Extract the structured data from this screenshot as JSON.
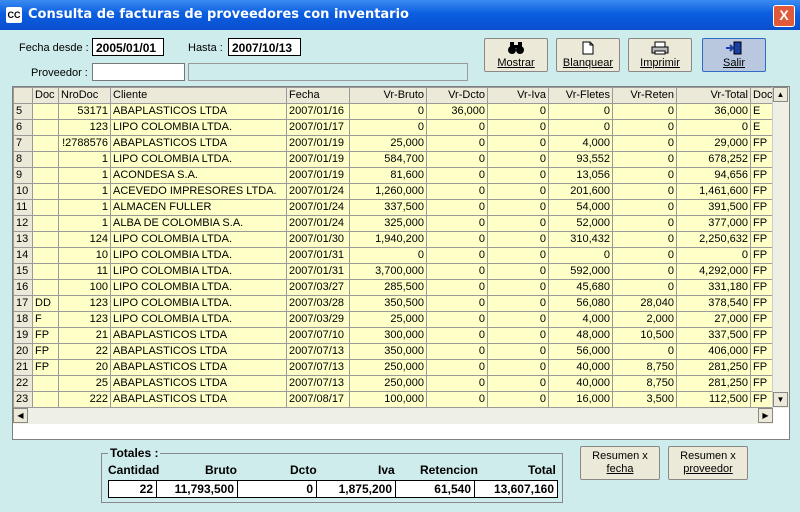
{
  "window": {
    "title": "Consulta de facturas de proveedores con inventario",
    "icon_text": "CC",
    "close_label": "X"
  },
  "filters": {
    "fecha_desde_label": "Fecha desde :",
    "fecha_desde_value": "2005/01/01",
    "hasta_label": "Hasta :",
    "hasta_value": "2007/10/13",
    "proveedor_label": "Proveedor :",
    "proveedor_value": "",
    "proveedor_name": ""
  },
  "toolbar": {
    "mostrar": "Mostrar",
    "blanquear": "Blanquear",
    "imprimir": "Imprimir",
    "salir": "Salir"
  },
  "grid": {
    "columns": [
      "",
      "Doc",
      "NroDoc",
      "Cliente",
      "Fecha",
      "Vr-Bruto",
      "Vr-Dcto",
      "Vr-Iva",
      "Vr-Fletes",
      "Vr-Reten",
      "Vr-Total",
      "Doc"
    ],
    "rows": [
      [
        "5",
        "",
        "53171",
        "ABAPLASTICOS LTDA",
        "2007/01/16",
        "0",
        "36,000",
        "0",
        "0",
        "0",
        "36,000",
        "E"
      ],
      [
        "6",
        "",
        "123",
        "LIPO COLOMBIA LTDA.",
        "2007/01/17",
        "0",
        "0",
        "0",
        "0",
        "0",
        "0",
        "E"
      ],
      [
        "7",
        "",
        "!2788576",
        "ABAPLASTICOS LTDA",
        "2007/01/19",
        "25,000",
        "0",
        "0",
        "4,000",
        "0",
        "29,000",
        "FP"
      ],
      [
        "8",
        "",
        "1",
        "LIPO COLOMBIA LTDA.",
        "2007/01/19",
        "584,700",
        "0",
        "0",
        "93,552",
        "0",
        "678,252",
        "FP"
      ],
      [
        "9",
        "",
        "1",
        "ACONDESA S.A.",
        "2007/01/19",
        "81,600",
        "0",
        "0",
        "13,056",
        "0",
        "94,656",
        "FP"
      ],
      [
        "10",
        "",
        "1",
        "ACEVEDO IMPRESORES LTDA.",
        "2007/01/24",
        "1,260,000",
        "0",
        "0",
        "201,600",
        "0",
        "1,461,600",
        "FP"
      ],
      [
        "11",
        "",
        "1",
        "ALMACEN FULLER",
        "2007/01/24",
        "337,500",
        "0",
        "0",
        "54,000",
        "0",
        "391,500",
        "FP"
      ],
      [
        "12",
        "",
        "1",
        "ALBA DE COLOMBIA S.A.",
        "2007/01/24",
        "325,000",
        "0",
        "0",
        "52,000",
        "0",
        "377,000",
        "FP"
      ],
      [
        "13",
        "",
        "124",
        "LIPO COLOMBIA LTDA.",
        "2007/01/30",
        "1,940,200",
        "0",
        "0",
        "310,432",
        "0",
        "2,250,632",
        "FP"
      ],
      [
        "14",
        "",
        "10",
        "LIPO COLOMBIA LTDA.",
        "2007/01/31",
        "0",
        "0",
        "0",
        "0",
        "0",
        "0",
        "FP"
      ],
      [
        "15",
        "",
        "11",
        "LIPO COLOMBIA LTDA.",
        "2007/01/31",
        "3,700,000",
        "0",
        "0",
        "592,000",
        "0",
        "4,292,000",
        "FP"
      ],
      [
        "16",
        "",
        "100",
        "LIPO COLOMBIA LTDA.",
        "2007/03/27",
        "285,500",
        "0",
        "0",
        "45,680",
        "0",
        "331,180",
        "FP"
      ],
      [
        "17",
        "DD",
        "123",
        "LIPO COLOMBIA LTDA.",
        "2007/03/28",
        "350,500",
        "0",
        "0",
        "56,080",
        "28,040",
        "378,540",
        "FP"
      ],
      [
        "18",
        "F",
        "123",
        "LIPO COLOMBIA LTDA.",
        "2007/03/29",
        "25,000",
        "0",
        "0",
        "4,000",
        "2,000",
        "27,000",
        "FP"
      ],
      [
        "19",
        "FP",
        "21",
        "ABAPLASTICOS LTDA",
        "2007/07/10",
        "300,000",
        "0",
        "0",
        "48,000",
        "10,500",
        "337,500",
        "FP"
      ],
      [
        "20",
        "FP",
        "22",
        "ABAPLASTICOS LTDA",
        "2007/07/13",
        "350,000",
        "0",
        "0",
        "56,000",
        "0",
        "406,000",
        "FP"
      ],
      [
        "21",
        "FP",
        "20",
        "ABAPLASTICOS LTDA",
        "2007/07/13",
        "250,000",
        "0",
        "0",
        "40,000",
        "8,750",
        "281,250",
        "FP"
      ],
      [
        "22",
        "",
        "25",
        "ABAPLASTICOS LTDA",
        "2007/07/13",
        "250,000",
        "0",
        "0",
        "40,000",
        "8,750",
        "281,250",
        "FP"
      ],
      [
        "23",
        "",
        "222",
        "ABAPLASTICOS LTDA",
        "2007/08/17",
        "100,000",
        "0",
        "0",
        "16,000",
        "3,500",
        "112,500",
        "FP"
      ]
    ]
  },
  "totals": {
    "title": "Totales :",
    "headers": [
      "Cantidad",
      "Bruto",
      "Dcto",
      "Iva",
      "Retencion",
      "Total"
    ],
    "values": [
      "22",
      "11,793,500",
      "0",
      "1,875,200",
      "61,540",
      "13,607,160"
    ]
  },
  "summary_buttons": {
    "by_date": [
      "Resumen x",
      "fecha"
    ],
    "by_supplier": [
      "Resumen x",
      "proveedor"
    ]
  },
  "icons": {
    "mostrar": "binoculars-icon",
    "blanquear": "blank-page-icon",
    "imprimir": "printer-icon",
    "salir": "exit-door-icon"
  }
}
